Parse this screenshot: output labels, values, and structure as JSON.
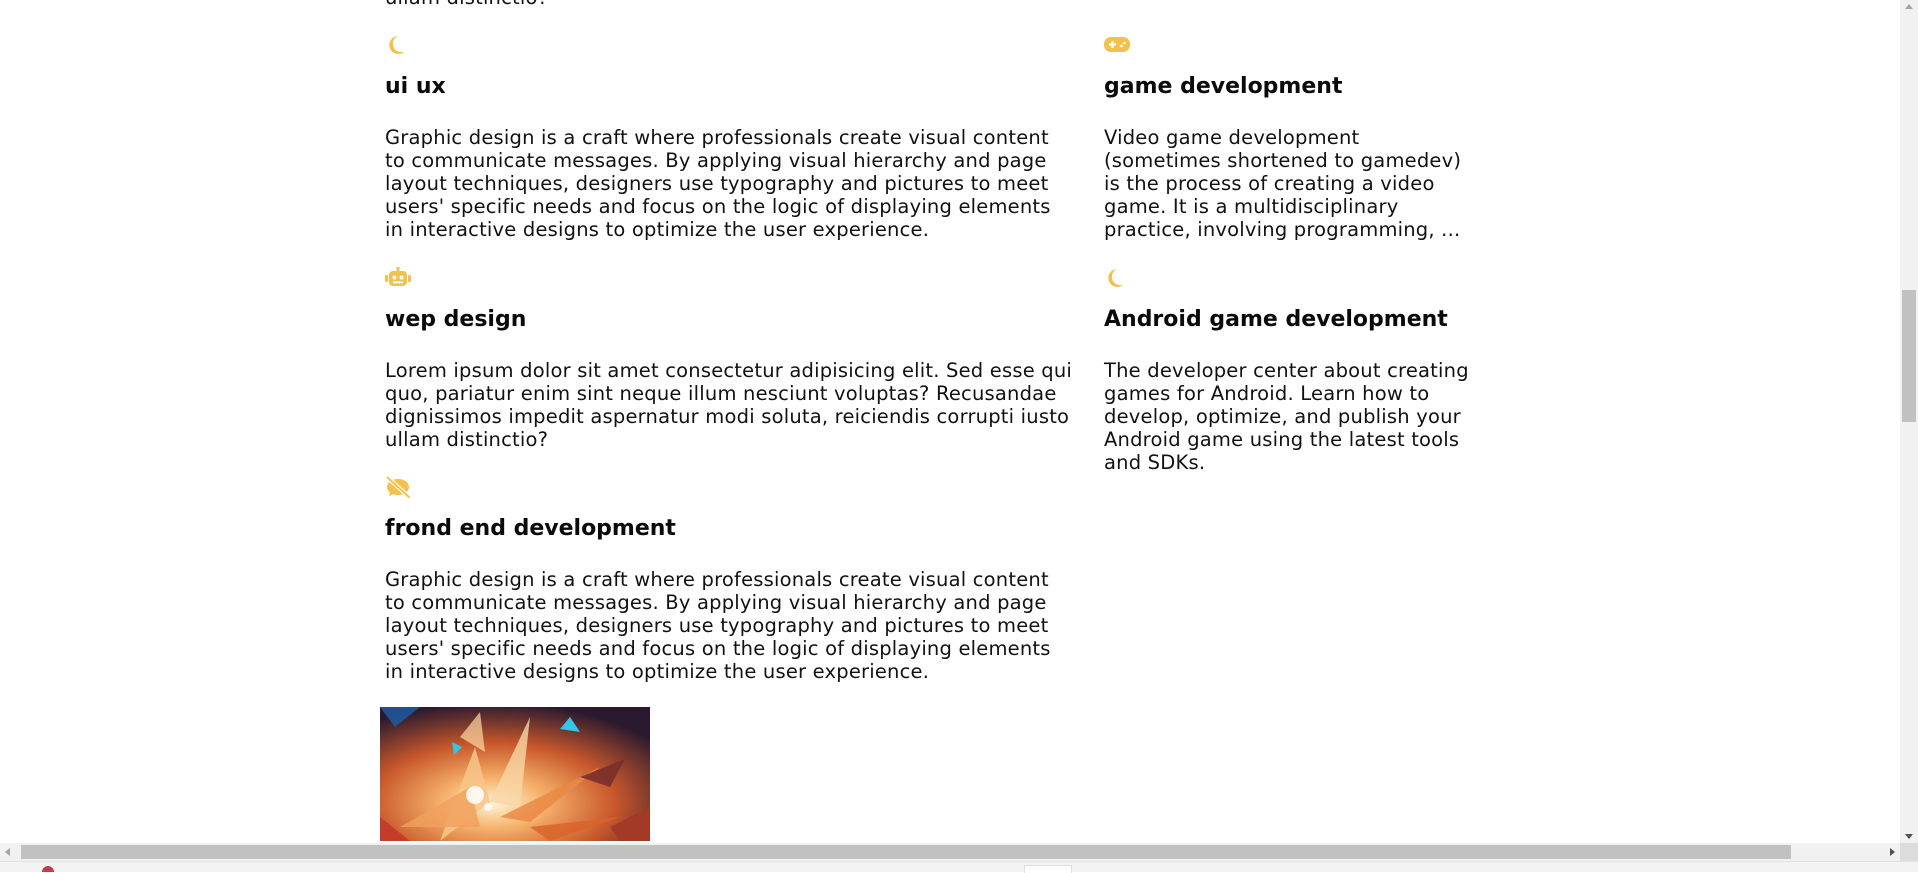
{
  "top_fragment": "ullam distinctio?",
  "accent_color": "#f2c14e",
  "services_left": [
    {
      "icon": "moon-icon",
      "title": "ui ux",
      "text": "Graphic design is a craft where professionals create visual content to communicate messages. By applying visual hierarchy and page layout techniques, designers use typography and pictures to meet users' specific needs and focus on the logic of displaying elements in interactive designs to optimize the user experience."
    },
    {
      "icon": "robot-icon",
      "title": "wep design",
      "text": "Lorem ipsum dolor sit amet consectetur adipisicing elit. Sed esse qui quo, pariatur enim sint neque illum nesciunt voluptas? Recusandae dignissimos impedit aspernatur modi soluta, reiciendis corrupti iusto ullam distinctio?"
    },
    {
      "icon": "comment-slash-icon",
      "title": "frond end development",
      "text": "Graphic design is a craft where professionals create visual content to communicate messages. By applying visual hierarchy and page layout techniques, designers use typography and pictures to meet users' specific needs and focus on the logic of displaying elements in interactive designs to optimize the user experience."
    }
  ],
  "services_right": [
    {
      "icon": "gamepad-icon",
      "title": "game development",
      "text": "Video game development (sometimes shortened to gamedev) is the process of creating a video game. It is a multidisciplinary practice, involving programming, ..."
    },
    {
      "icon": "moon-icon",
      "title": "Android game development",
      "text": "The developer center about creating games for Android. Learn how to develop, optimize, and publish your Android game using the latest tools and SDKs."
    }
  ],
  "image": {
    "subject": "abstract-flower-artwork-icon"
  }
}
